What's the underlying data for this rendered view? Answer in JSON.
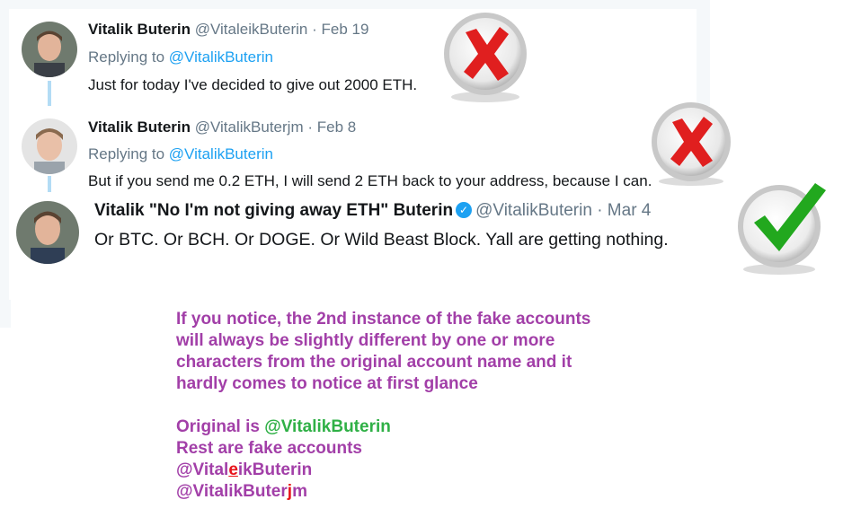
{
  "tweets": [
    {
      "name": "Vitalik Buterin",
      "handle": "@VitaleikButerin",
      "date": "Feb 19",
      "replying_prefix": "Replying to",
      "replying_to": "@VitalikButerin",
      "text": "Just for today I've decided to give out 2000 ETH.",
      "mark": "red-x"
    },
    {
      "name": "Vitalik Buterin",
      "handle": "@VitalikButerjm",
      "date": "Feb 8",
      "replying_prefix": "Replying to",
      "replying_to": "@VitalikButerin",
      "text": "But if you send me 0.2 ETH, I will send 2 ETH back to your address, because I can.",
      "mark": "red-x"
    },
    {
      "name": "Vitalik \"No I'm not giving away ETH\" Buterin",
      "handle": "@VitalikButerin",
      "date": "Mar 4",
      "text": "Or BTC. Or BCH. Or DOGE. Or Wild Beast Block. Yall are getting nothing.",
      "verified": true,
      "mark": "green-check"
    }
  ],
  "separator": "·",
  "note": {
    "paragraph_lines": [
      "If you notice, the 2nd instance of the fake accounts",
      "will always be slightly different by one or more",
      "characters from the original account name and it",
      "hardly comes to notice at first glance"
    ],
    "original_prefix": "Original is ",
    "original_handle": "@VitalikButerin",
    "rest_line": "Rest are fake accounts",
    "fake1_pre": "@Vital",
    "fake1_highlight": "e",
    "fake1_post": "ikButerin",
    "fake2_pre": "@VitalikButer",
    "fake2_highlight": "j",
    "fake2_post": "m"
  },
  "colors": {
    "note_text": "#a23fa8",
    "original_handle": "#2fb046",
    "highlight": "#e8141b",
    "link": "#1da1f2",
    "verified": "#1da1f2"
  }
}
